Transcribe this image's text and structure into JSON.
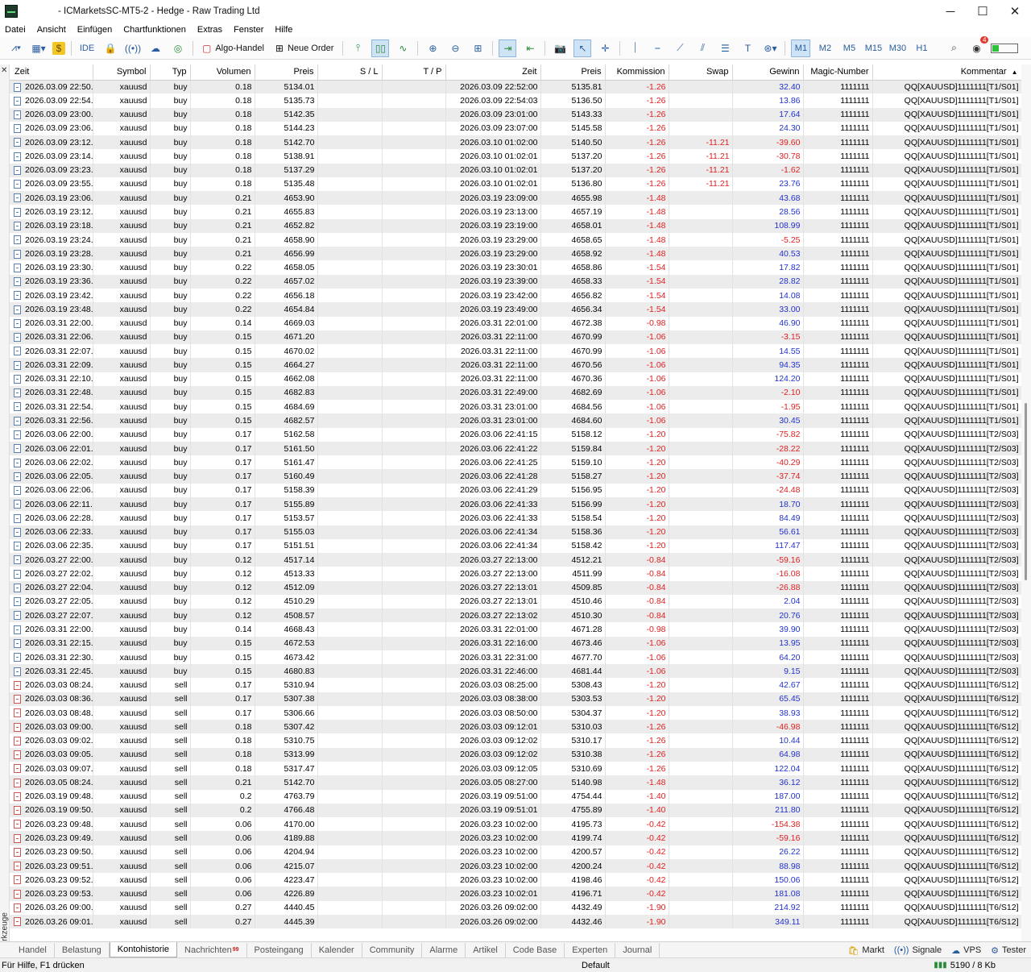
{
  "window": {
    "title": "- ICMarketsSC-MT5-2 - Hedge - Raw Trading Ltd",
    "minimize": "─",
    "maximize": "☐",
    "close": "✕"
  },
  "menu": [
    "Datei",
    "Ansicht",
    "Einfügen",
    "Chartfunktionen",
    "Extras",
    "Fenster",
    "Hilfe"
  ],
  "toolbar": {
    "ide_label": "IDE",
    "algo_label": "Algo-Handel",
    "new_order_label": "Neue Order",
    "timeframes": [
      "M1",
      "M2",
      "M5",
      "M15",
      "M30",
      "H1"
    ],
    "active_timeframe": "M1",
    "notification_count": "4"
  },
  "sidebar": {
    "close": "✕",
    "label": "Werkzeuge"
  },
  "table": {
    "columns": [
      "Zeit",
      "Symbol",
      "Typ",
      "Volumen",
      "Preis",
      "S / L",
      "T / P",
      "Zeit",
      "Preis",
      "Kommission",
      "Swap",
      "Gewinn",
      "Magic-Number",
      "Kommentar"
    ],
    "rows": [
      [
        "2026.03.09 22:50...",
        "xauusd",
        "buy",
        "0.18",
        "5134.01",
        "",
        "",
        "2026.03.09 22:52:00",
        "5135.81",
        "-1.26",
        "",
        "32.40",
        "1111111",
        "QQ[XAUUSD]1111111[T1/S01]"
      ],
      [
        "2026.03.09 22:54...",
        "xauusd",
        "buy",
        "0.18",
        "5135.73",
        "",
        "",
        "2026.03.09 22:54:03",
        "5136.50",
        "-1.26",
        "",
        "13.86",
        "1111111",
        "QQ[XAUUSD]1111111[T1/S01]"
      ],
      [
        "2026.03.09 23:00...",
        "xauusd",
        "buy",
        "0.18",
        "5142.35",
        "",
        "",
        "2026.03.09 23:01:00",
        "5143.33",
        "-1.26",
        "",
        "17.64",
        "1111111",
        "QQ[XAUUSD]1111111[T1/S01]"
      ],
      [
        "2026.03.09 23:06...",
        "xauusd",
        "buy",
        "0.18",
        "5144.23",
        "",
        "",
        "2026.03.09 23:07:00",
        "5145.58",
        "-1.26",
        "",
        "24.30",
        "1111111",
        "QQ[XAUUSD]1111111[T1/S01]"
      ],
      [
        "2026.03.09 23:12...",
        "xauusd",
        "buy",
        "0.18",
        "5142.70",
        "",
        "",
        "2026.03.10 01:02:00",
        "5140.50",
        "-1.26",
        "-11.21",
        "-39.60",
        "1111111",
        "QQ[XAUUSD]1111111[T1/S01]"
      ],
      [
        "2026.03.09 23:14...",
        "xauusd",
        "buy",
        "0.18",
        "5138.91",
        "",
        "",
        "2026.03.10 01:02:01",
        "5137.20",
        "-1.26",
        "-11.21",
        "-30.78",
        "1111111",
        "QQ[XAUUSD]1111111[T1/S01]"
      ],
      [
        "2026.03.09 23:23...",
        "xauusd",
        "buy",
        "0.18",
        "5137.29",
        "",
        "",
        "2026.03.10 01:02:01",
        "5137.20",
        "-1.26",
        "-11.21",
        "-1.62",
        "1111111",
        "QQ[XAUUSD]1111111[T1/S01]"
      ],
      [
        "2026.03.09 23:55...",
        "xauusd",
        "buy",
        "0.18",
        "5135.48",
        "",
        "",
        "2026.03.10 01:02:01",
        "5136.80",
        "-1.26",
        "-11.21",
        "23.76",
        "1111111",
        "QQ[XAUUSD]1111111[T1/S01]"
      ],
      [
        "2026.03.19 23:06...",
        "xauusd",
        "buy",
        "0.21",
        "4653.90",
        "",
        "",
        "2026.03.19 23:09:00",
        "4655.98",
        "-1.48",
        "",
        "43.68",
        "1111111",
        "QQ[XAUUSD]1111111[T1/S01]"
      ],
      [
        "2026.03.19 23:12...",
        "xauusd",
        "buy",
        "0.21",
        "4655.83",
        "",
        "",
        "2026.03.19 23:13:00",
        "4657.19",
        "-1.48",
        "",
        "28.56",
        "1111111",
        "QQ[XAUUSD]1111111[T1/S01]"
      ],
      [
        "2026.03.19 23:18...",
        "xauusd",
        "buy",
        "0.21",
        "4652.82",
        "",
        "",
        "2026.03.19 23:19:00",
        "4658.01",
        "-1.48",
        "",
        "108.99",
        "1111111",
        "QQ[XAUUSD]1111111[T1/S01]"
      ],
      [
        "2026.03.19 23:24...",
        "xauusd",
        "buy",
        "0.21",
        "4658.90",
        "",
        "",
        "2026.03.19 23:29:00",
        "4658.65",
        "-1.48",
        "",
        "-5.25",
        "1111111",
        "QQ[XAUUSD]1111111[T1/S01]"
      ],
      [
        "2026.03.19 23:28...",
        "xauusd",
        "buy",
        "0.21",
        "4656.99",
        "",
        "",
        "2026.03.19 23:29:00",
        "4658.92",
        "-1.48",
        "",
        "40.53",
        "1111111",
        "QQ[XAUUSD]1111111[T1/S01]"
      ],
      [
        "2026.03.19 23:30...",
        "xauusd",
        "buy",
        "0.22",
        "4658.05",
        "",
        "",
        "2026.03.19 23:30:01",
        "4658.86",
        "-1.54",
        "",
        "17.82",
        "1111111",
        "QQ[XAUUSD]1111111[T1/S01]"
      ],
      [
        "2026.03.19 23:36...",
        "xauusd",
        "buy",
        "0.22",
        "4657.02",
        "",
        "",
        "2026.03.19 23:39:00",
        "4658.33",
        "-1.54",
        "",
        "28.82",
        "1111111",
        "QQ[XAUUSD]1111111[T1/S01]"
      ],
      [
        "2026.03.19 23:42...",
        "xauusd",
        "buy",
        "0.22",
        "4656.18",
        "",
        "",
        "2026.03.19 23:42:00",
        "4656.82",
        "-1.54",
        "",
        "14.08",
        "1111111",
        "QQ[XAUUSD]1111111[T1/S01]"
      ],
      [
        "2026.03.19 23:48...",
        "xauusd",
        "buy",
        "0.22",
        "4654.84",
        "",
        "",
        "2026.03.19 23:49:00",
        "4656.34",
        "-1.54",
        "",
        "33.00",
        "1111111",
        "QQ[XAUUSD]1111111[T1/S01]"
      ],
      [
        "2026.03.31 22:00...",
        "xauusd",
        "buy",
        "0.14",
        "4669.03",
        "",
        "",
        "2026.03.31 22:01:00",
        "4672.38",
        "-0.98",
        "",
        "46.90",
        "1111111",
        "QQ[XAUUSD]1111111[T1/S01]"
      ],
      [
        "2026.03.31 22:06...",
        "xauusd",
        "buy",
        "0.15",
        "4671.20",
        "",
        "",
        "2026.03.31 22:11:00",
        "4670.99",
        "-1.06",
        "",
        "-3.15",
        "1111111",
        "QQ[XAUUSD]1111111[T1/S01]"
      ],
      [
        "2026.03.31 22:07...",
        "xauusd",
        "buy",
        "0.15",
        "4670.02",
        "",
        "",
        "2026.03.31 22:11:00",
        "4670.99",
        "-1.06",
        "",
        "14.55",
        "1111111",
        "QQ[XAUUSD]1111111[T1/S01]"
      ],
      [
        "2026.03.31 22:09...",
        "xauusd",
        "buy",
        "0.15",
        "4664.27",
        "",
        "",
        "2026.03.31 22:11:00",
        "4670.56",
        "-1.06",
        "",
        "94.35",
        "1111111",
        "QQ[XAUUSD]1111111[T1/S01]"
      ],
      [
        "2026.03.31 22:10...",
        "xauusd",
        "buy",
        "0.15",
        "4662.08",
        "",
        "",
        "2026.03.31 22:11:00",
        "4670.36",
        "-1.06",
        "",
        "124.20",
        "1111111",
        "QQ[XAUUSD]1111111[T1/S01]"
      ],
      [
        "2026.03.31 22:48...",
        "xauusd",
        "buy",
        "0.15",
        "4682.83",
        "",
        "",
        "2026.03.31 22:49:00",
        "4682.69",
        "-1.06",
        "",
        "-2.10",
        "1111111",
        "QQ[XAUUSD]1111111[T1/S01]"
      ],
      [
        "2026.03.31 22:54...",
        "xauusd",
        "buy",
        "0.15",
        "4684.69",
        "",
        "",
        "2026.03.31 23:01:00",
        "4684.56",
        "-1.06",
        "",
        "-1.95",
        "1111111",
        "QQ[XAUUSD]1111111[T1/S01]"
      ],
      [
        "2026.03.31 22:56...",
        "xauusd",
        "buy",
        "0.15",
        "4682.57",
        "",
        "",
        "2026.03.31 23:01:00",
        "4684.60",
        "-1.06",
        "",
        "30.45",
        "1111111",
        "QQ[XAUUSD]1111111[T1/S01]"
      ],
      [
        "2026.03.06 22:00...",
        "xauusd",
        "buy",
        "0.17",
        "5162.58",
        "",
        "",
        "2026.03.06 22:41:15",
        "5158.12",
        "-1.20",
        "",
        "-75.82",
        "1111111",
        "QQ[XAUUSD]1111111[T2/S03]"
      ],
      [
        "2026.03.06 22:01...",
        "xauusd",
        "buy",
        "0.17",
        "5161.50",
        "",
        "",
        "2026.03.06 22:41:22",
        "5159.84",
        "-1.20",
        "",
        "-28.22",
        "1111111",
        "QQ[XAUUSD]1111111[T2/S03]"
      ],
      [
        "2026.03.06 22:02...",
        "xauusd",
        "buy",
        "0.17",
        "5161.47",
        "",
        "",
        "2026.03.06 22:41:25",
        "5159.10",
        "-1.20",
        "",
        "-40.29",
        "1111111",
        "QQ[XAUUSD]1111111[T2/S03]"
      ],
      [
        "2026.03.06 22:05...",
        "xauusd",
        "buy",
        "0.17",
        "5160.49",
        "",
        "",
        "2026.03.06 22:41:28",
        "5158.27",
        "-1.20",
        "",
        "-37.74",
        "1111111",
        "QQ[XAUUSD]1111111[T2/S03]"
      ],
      [
        "2026.03.06 22:06...",
        "xauusd",
        "buy",
        "0.17",
        "5158.39",
        "",
        "",
        "2026.03.06 22:41:29",
        "5156.95",
        "-1.20",
        "",
        "-24.48",
        "1111111",
        "QQ[XAUUSD]1111111[T2/S03]"
      ],
      [
        "2026.03.06 22:11...",
        "xauusd",
        "buy",
        "0.17",
        "5155.89",
        "",
        "",
        "2026.03.06 22:41:33",
        "5156.99",
        "-1.20",
        "",
        "18.70",
        "1111111",
        "QQ[XAUUSD]1111111[T2/S03]"
      ],
      [
        "2026.03.06 22:28...",
        "xauusd",
        "buy",
        "0.17",
        "5153.57",
        "",
        "",
        "2026.03.06 22:41:33",
        "5158.54",
        "-1.20",
        "",
        "84.49",
        "1111111",
        "QQ[XAUUSD]1111111[T2/S03]"
      ],
      [
        "2026.03.06 22:33...",
        "xauusd",
        "buy",
        "0.17",
        "5155.03",
        "",
        "",
        "2026.03.06 22:41:34",
        "5158.36",
        "-1.20",
        "",
        "56.61",
        "1111111",
        "QQ[XAUUSD]1111111[T2/S03]"
      ],
      [
        "2026.03.06 22:35...",
        "xauusd",
        "buy",
        "0.17",
        "5151.51",
        "",
        "",
        "2026.03.06 22:41:34",
        "5158.42",
        "-1.20",
        "",
        "117.47",
        "1111111",
        "QQ[XAUUSD]1111111[T2/S03]"
      ],
      [
        "2026.03.27 22:00...",
        "xauusd",
        "buy",
        "0.12",
        "4517.14",
        "",
        "",
        "2026.03.27 22:13:00",
        "4512.21",
        "-0.84",
        "",
        "-59.16",
        "1111111",
        "QQ[XAUUSD]1111111[T2/S03]"
      ],
      [
        "2026.03.27 22:02...",
        "xauusd",
        "buy",
        "0.12",
        "4513.33",
        "",
        "",
        "2026.03.27 22:13:00",
        "4511.99",
        "-0.84",
        "",
        "-16.08",
        "1111111",
        "QQ[XAUUSD]1111111[T2/S03]"
      ],
      [
        "2026.03.27 22:04...",
        "xauusd",
        "buy",
        "0.12",
        "4512.09",
        "",
        "",
        "2026.03.27 22:13:01",
        "4509.85",
        "-0.84",
        "",
        "-26.88",
        "1111111",
        "QQ[XAUUSD]1111111[T2/S03]"
      ],
      [
        "2026.03.27 22:05...",
        "xauusd",
        "buy",
        "0.12",
        "4510.29",
        "",
        "",
        "2026.03.27 22:13:01",
        "4510.46",
        "-0.84",
        "",
        "2.04",
        "1111111",
        "QQ[XAUUSD]1111111[T2/S03]"
      ],
      [
        "2026.03.27 22:07...",
        "xauusd",
        "buy",
        "0.12",
        "4508.57",
        "",
        "",
        "2026.03.27 22:13:02",
        "4510.30",
        "-0.84",
        "",
        "20.76",
        "1111111",
        "QQ[XAUUSD]1111111[T2/S03]"
      ],
      [
        "2026.03.31 22:00...",
        "xauusd",
        "buy",
        "0.14",
        "4668.43",
        "",
        "",
        "2026.03.31 22:01:00",
        "4671.28",
        "-0.98",
        "",
        "39.90",
        "1111111",
        "QQ[XAUUSD]1111111[T2/S03]"
      ],
      [
        "2026.03.31 22:15...",
        "xauusd",
        "buy",
        "0.15",
        "4672.53",
        "",
        "",
        "2026.03.31 22:16:00",
        "4673.46",
        "-1.06",
        "",
        "13.95",
        "1111111",
        "QQ[XAUUSD]1111111[T2/S03]"
      ],
      [
        "2026.03.31 22:30...",
        "xauusd",
        "buy",
        "0.15",
        "4673.42",
        "",
        "",
        "2026.03.31 22:31:00",
        "4677.70",
        "-1.06",
        "",
        "64.20",
        "1111111",
        "QQ[XAUUSD]1111111[T2/S03]"
      ],
      [
        "2026.03.31 22:45...",
        "xauusd",
        "buy",
        "0.15",
        "4680.83",
        "",
        "",
        "2026.03.31 22:46:00",
        "4681.44",
        "-1.06",
        "",
        "9.15",
        "1111111",
        "QQ[XAUUSD]1111111[T2/S03]"
      ],
      [
        "2026.03.03 08:24...",
        "xauusd",
        "sell",
        "0.17",
        "5310.94",
        "",
        "",
        "2026.03.03 08:25:00",
        "5308.43",
        "-1.20",
        "",
        "42.67",
        "1111111",
        "QQ[XAUUSD]1111111[T6/S12]"
      ],
      [
        "2026.03.03 08:36...",
        "xauusd",
        "sell",
        "0.17",
        "5307.38",
        "",
        "",
        "2026.03.03 08:38:00",
        "5303.53",
        "-1.20",
        "",
        "65.45",
        "1111111",
        "QQ[XAUUSD]1111111[T6/S12]"
      ],
      [
        "2026.03.03 08:48...",
        "xauusd",
        "sell",
        "0.17",
        "5306.66",
        "",
        "",
        "2026.03.03 08:50:00",
        "5304.37",
        "-1.20",
        "",
        "38.93",
        "1111111",
        "QQ[XAUUSD]1111111[T6/S12]"
      ],
      [
        "2026.03.03 09:00...",
        "xauusd",
        "sell",
        "0.18",
        "5307.42",
        "",
        "",
        "2026.03.03 09:12:01",
        "5310.03",
        "-1.26",
        "",
        "-46.98",
        "1111111",
        "QQ[XAUUSD]1111111[T6/S12]"
      ],
      [
        "2026.03.03 09:02...",
        "xauusd",
        "sell",
        "0.18",
        "5310.75",
        "",
        "",
        "2026.03.03 09:12:02",
        "5310.17",
        "-1.26",
        "",
        "10.44",
        "1111111",
        "QQ[XAUUSD]1111111[T6/S12]"
      ],
      [
        "2026.03.03 09:05...",
        "xauusd",
        "sell",
        "0.18",
        "5313.99",
        "",
        "",
        "2026.03.03 09:12:02",
        "5310.38",
        "-1.26",
        "",
        "64.98",
        "1111111",
        "QQ[XAUUSD]1111111[T6/S12]"
      ],
      [
        "2026.03.03 09:07...",
        "xauusd",
        "sell",
        "0.18",
        "5317.47",
        "",
        "",
        "2026.03.03 09:12:05",
        "5310.69",
        "-1.26",
        "",
        "122.04",
        "1111111",
        "QQ[XAUUSD]1111111[T6/S12]"
      ],
      [
        "2026.03.05 08:24...",
        "xauusd",
        "sell",
        "0.21",
        "5142.70",
        "",
        "",
        "2026.03.05 08:27:00",
        "5140.98",
        "-1.48",
        "",
        "36.12",
        "1111111",
        "QQ[XAUUSD]1111111[T6/S12]"
      ],
      [
        "2026.03.19 09:48...",
        "xauusd",
        "sell",
        "0.2",
        "4763.79",
        "",
        "",
        "2026.03.19 09:51:00",
        "4754.44",
        "-1.40",
        "",
        "187.00",
        "1111111",
        "QQ[XAUUSD]1111111[T6/S12]"
      ],
      [
        "2026.03.19 09:50...",
        "xauusd",
        "sell",
        "0.2",
        "4766.48",
        "",
        "",
        "2026.03.19 09:51:01",
        "4755.89",
        "-1.40",
        "",
        "211.80",
        "1111111",
        "QQ[XAUUSD]1111111[T6/S12]"
      ],
      [
        "2026.03.23 09:48...",
        "xauusd",
        "sell",
        "0.06",
        "4170.00",
        "",
        "",
        "2026.03.23 10:02:00",
        "4195.73",
        "-0.42",
        "",
        "-154.38",
        "1111111",
        "QQ[XAUUSD]1111111[T6/S12]"
      ],
      [
        "2026.03.23 09:49...",
        "xauusd",
        "sell",
        "0.06",
        "4189.88",
        "",
        "",
        "2026.03.23 10:02:00",
        "4199.74",
        "-0.42",
        "",
        "-59.16",
        "1111111",
        "QQ[XAUUSD]1111111[T6/S12]"
      ],
      [
        "2026.03.23 09:50...",
        "xauusd",
        "sell",
        "0.06",
        "4204.94",
        "",
        "",
        "2026.03.23 10:02:00",
        "4200.57",
        "-0.42",
        "",
        "26.22",
        "1111111",
        "QQ[XAUUSD]1111111[T6/S12]"
      ],
      [
        "2026.03.23 09:51...",
        "xauusd",
        "sell",
        "0.06",
        "4215.07",
        "",
        "",
        "2026.03.23 10:02:00",
        "4200.24",
        "-0.42",
        "",
        "88.98",
        "1111111",
        "QQ[XAUUSD]1111111[T6/S12]"
      ],
      [
        "2026.03.23 09:52...",
        "xauusd",
        "sell",
        "0.06",
        "4223.47",
        "",
        "",
        "2026.03.23 10:02:00",
        "4198.46",
        "-0.42",
        "",
        "150.06",
        "1111111",
        "QQ[XAUUSD]1111111[T6/S12]"
      ],
      [
        "2026.03.23 09:53...",
        "xauusd",
        "sell",
        "0.06",
        "4226.89",
        "",
        "",
        "2026.03.23 10:02:01",
        "4196.71",
        "-0.42",
        "",
        "181.08",
        "1111111",
        "QQ[XAUUSD]1111111[T6/S12]"
      ],
      [
        "2026.03.26 09:00...",
        "xauusd",
        "sell",
        "0.27",
        "4440.45",
        "",
        "",
        "2026.03.26 09:02:00",
        "4432.49",
        "-1.90",
        "",
        "214.92",
        "1111111",
        "QQ[XAUUSD]1111111[T6/S12]"
      ],
      [
        "2026.03.26 09:01...",
        "xauusd",
        "sell",
        "0.27",
        "4445.39",
        "",
        "",
        "2026.03.26 09:02:00",
        "4432.46",
        "-1.90",
        "",
        "349.11",
        "1111111",
        "QQ[XAUUSD]1111111[T6/S12]"
      ]
    ]
  },
  "tabs": [
    "Handel",
    "Belastung",
    "Kontohistorie",
    "Nachrichten",
    "Posteingang",
    "Kalender",
    "Community",
    "Alarme",
    "Artikel",
    "Code Base",
    "Experten",
    "Journal"
  ],
  "tab_badge": "99",
  "active_tab": "Kontohistorie",
  "tabs_right": [
    "Markt",
    "Signale",
    "VPS",
    "Tester"
  ],
  "status": {
    "help": "Für Hilfe, F1 drücken",
    "profile": "Default",
    "traffic": "5190 / 8 Kb"
  }
}
